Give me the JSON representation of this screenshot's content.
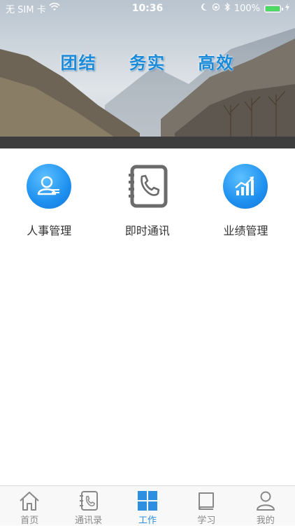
{
  "status_bar": {
    "carrier": "无 SIM 卡",
    "time": "10:36",
    "battery_percent": "100%",
    "battery_level": 1.0
  },
  "banner": {
    "slogan": [
      "团结",
      "务实",
      "高效"
    ]
  },
  "menu": {
    "items": [
      {
        "label": "人事管理",
        "icon": "person-card-icon"
      },
      {
        "label": "即时通讯",
        "icon": "phone-book-icon"
      },
      {
        "label": "业绩管理",
        "icon": "growth-chart-icon"
      }
    ]
  },
  "tabbar": {
    "active_color": "#2e8fe0",
    "inactive_color": "#888888",
    "tabs": [
      {
        "label": "首页",
        "icon": "home-icon",
        "active": false
      },
      {
        "label": "通讯录",
        "icon": "contacts-icon",
        "active": false
      },
      {
        "label": "工作",
        "icon": "grid-icon",
        "active": true
      },
      {
        "label": "学习",
        "icon": "book-icon",
        "active": false
      },
      {
        "label": "我的",
        "icon": "user-icon",
        "active": false
      }
    ]
  }
}
